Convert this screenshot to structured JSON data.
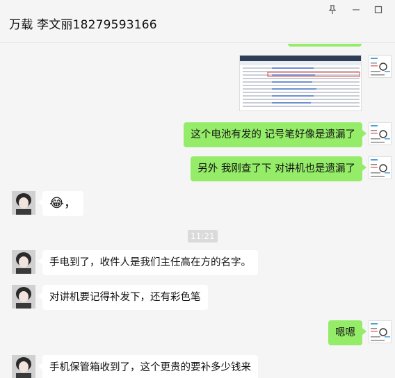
{
  "window": {
    "title": "万载 李文丽18279593166",
    "pin_icon": "pin-icon",
    "minimize_icon": "minimize-icon",
    "maximize_icon": "maximize-icon"
  },
  "messages": [
    {
      "from": "me",
      "type": "image"
    },
    {
      "from": "me",
      "type": "text",
      "text": "这个电池有发的  记号笔好像是遗漏了"
    },
    {
      "from": "me",
      "type": "text",
      "text": "另外 我刚查了下 对讲机也是遗漏了"
    },
    {
      "from": "other",
      "type": "emoji",
      "text": "😂，"
    },
    {
      "from": "system",
      "type": "time",
      "text": "11:21"
    },
    {
      "from": "other",
      "type": "text",
      "text": "手电到了，收件人是我们主任高在方的名字。"
    },
    {
      "from": "other",
      "type": "text",
      "text": "对讲机要记得补发下，还有彩色笔"
    },
    {
      "from": "me",
      "type": "text",
      "text": "嗯嗯"
    },
    {
      "from": "other",
      "type": "text",
      "text": "手机保管箱收到了，这个更贵的要补多少钱来"
    }
  ],
  "colors": {
    "me_bubble": "#95ec69",
    "other_bubble": "#ffffff",
    "background": "#f5f5f5"
  }
}
